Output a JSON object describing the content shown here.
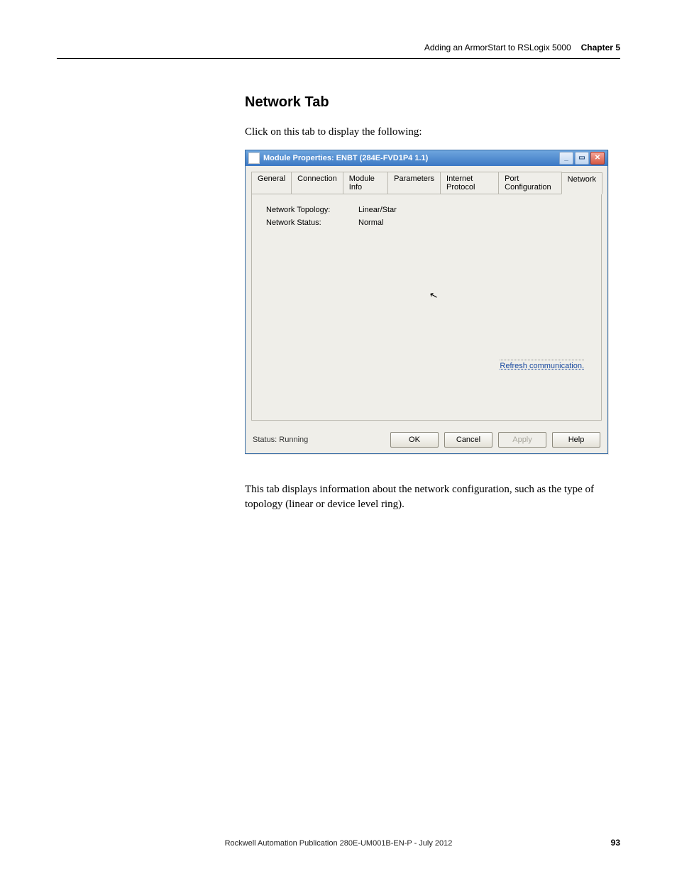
{
  "header": {
    "title": "Adding an ArmorStart to RSLogix 5000",
    "chapter": "Chapter 5"
  },
  "section": {
    "heading": "Network Tab",
    "intro": "Click on this tab to display the following:",
    "explain": "This tab displays information about the network configuration, such as the type of topology (linear or device level ring)."
  },
  "dialog": {
    "title": "Module Properties: ENBT (284E-FVD1P4 1.1)",
    "tabs": {
      "general": "General",
      "connection": "Connection",
      "moduleinfo": "Module Info",
      "parameters": "Parameters",
      "internetprotocol": "Internet Protocol",
      "portconfig": "Port Configuration",
      "network": "Network"
    },
    "fields": {
      "topology_label": "Network Topology:",
      "topology_value": "Linear/Star",
      "status_label": "Network Status:",
      "status_value": "Normal"
    },
    "refresh_link": "Refresh communication.",
    "footer": {
      "status": "Status: Running",
      "ok": "OK",
      "cancel": "Cancel",
      "apply": "Apply",
      "help": "Help"
    },
    "winbtn": {
      "min": "_",
      "max": "▭",
      "close": "✕"
    }
  },
  "footer": {
    "publication": "Rockwell Automation Publication 280E-UM001B-EN-P - July 2012",
    "page": "93"
  }
}
